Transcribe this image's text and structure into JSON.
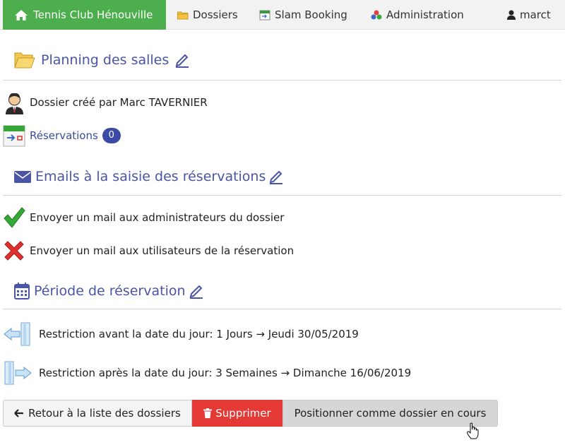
{
  "navbar": {
    "brand": "Tennis Club Hénouville",
    "dossiers": "Dossiers",
    "slam": "Slam Booking",
    "admin": "Administration",
    "user": "marct"
  },
  "planning": {
    "title": "Planning des salles",
    "created_by": "Dossier créé par Marc TAVERNIER",
    "reservations_label": "Réservations",
    "reservations_count": "0"
  },
  "emails": {
    "title": "Emails à la saisie des réservations",
    "admins": "Envoyer un mail aux administrateurs du dossier",
    "users": "Envoyer un mail aux utilisateurs de la réservation"
  },
  "periode": {
    "title": "Période de réservation",
    "before": "Restriction avant la date du jour: 1 Jours → Jeudi 30/05/2019",
    "after": "Restriction après la date du jour: 3 Semaines → Dimanche 16/06/2019"
  },
  "buttons": {
    "back": "Retour à la liste des dossiers",
    "delete": "Supprimer",
    "position": "Positionner comme dossier en cours"
  },
  "colors": {
    "brand": "#4cae4c",
    "accent": "#4a55a5",
    "danger": "#e53935"
  }
}
